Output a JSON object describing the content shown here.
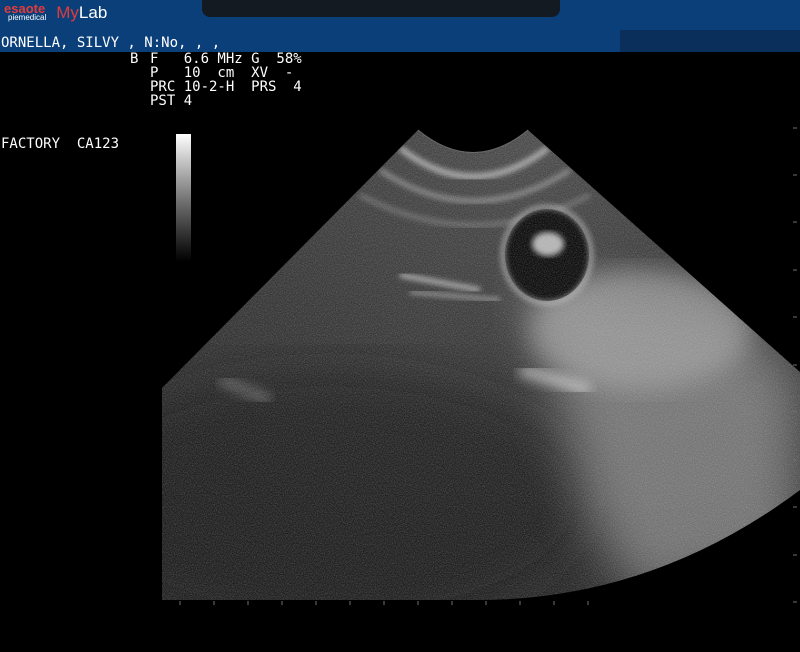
{
  "header": {
    "brand_name": "esaote",
    "brand_sub": "piemedical",
    "product_prefix": "My",
    "product_suffix": "Lab",
    "bar_color": "#0a3f7a"
  },
  "patient": {
    "line": "ORNELLA, SILVY , N:No, , ,"
  },
  "params": {
    "mode": "B",
    "row1": "F   6.6 MHz G  58%",
    "row2": "P   10  cm  XV  -",
    "row3": "PRC 10-2-H  PRS  4",
    "row4": "PST 4"
  },
  "preset": {
    "line": "FACTORY  CA123"
  },
  "image": {
    "type": "convex-sector B-mode ultrasound",
    "colors": {
      "background": "#000000",
      "tissue_base": "#3c3c3c",
      "bright_echo": "#cfcfcf"
    }
  }
}
